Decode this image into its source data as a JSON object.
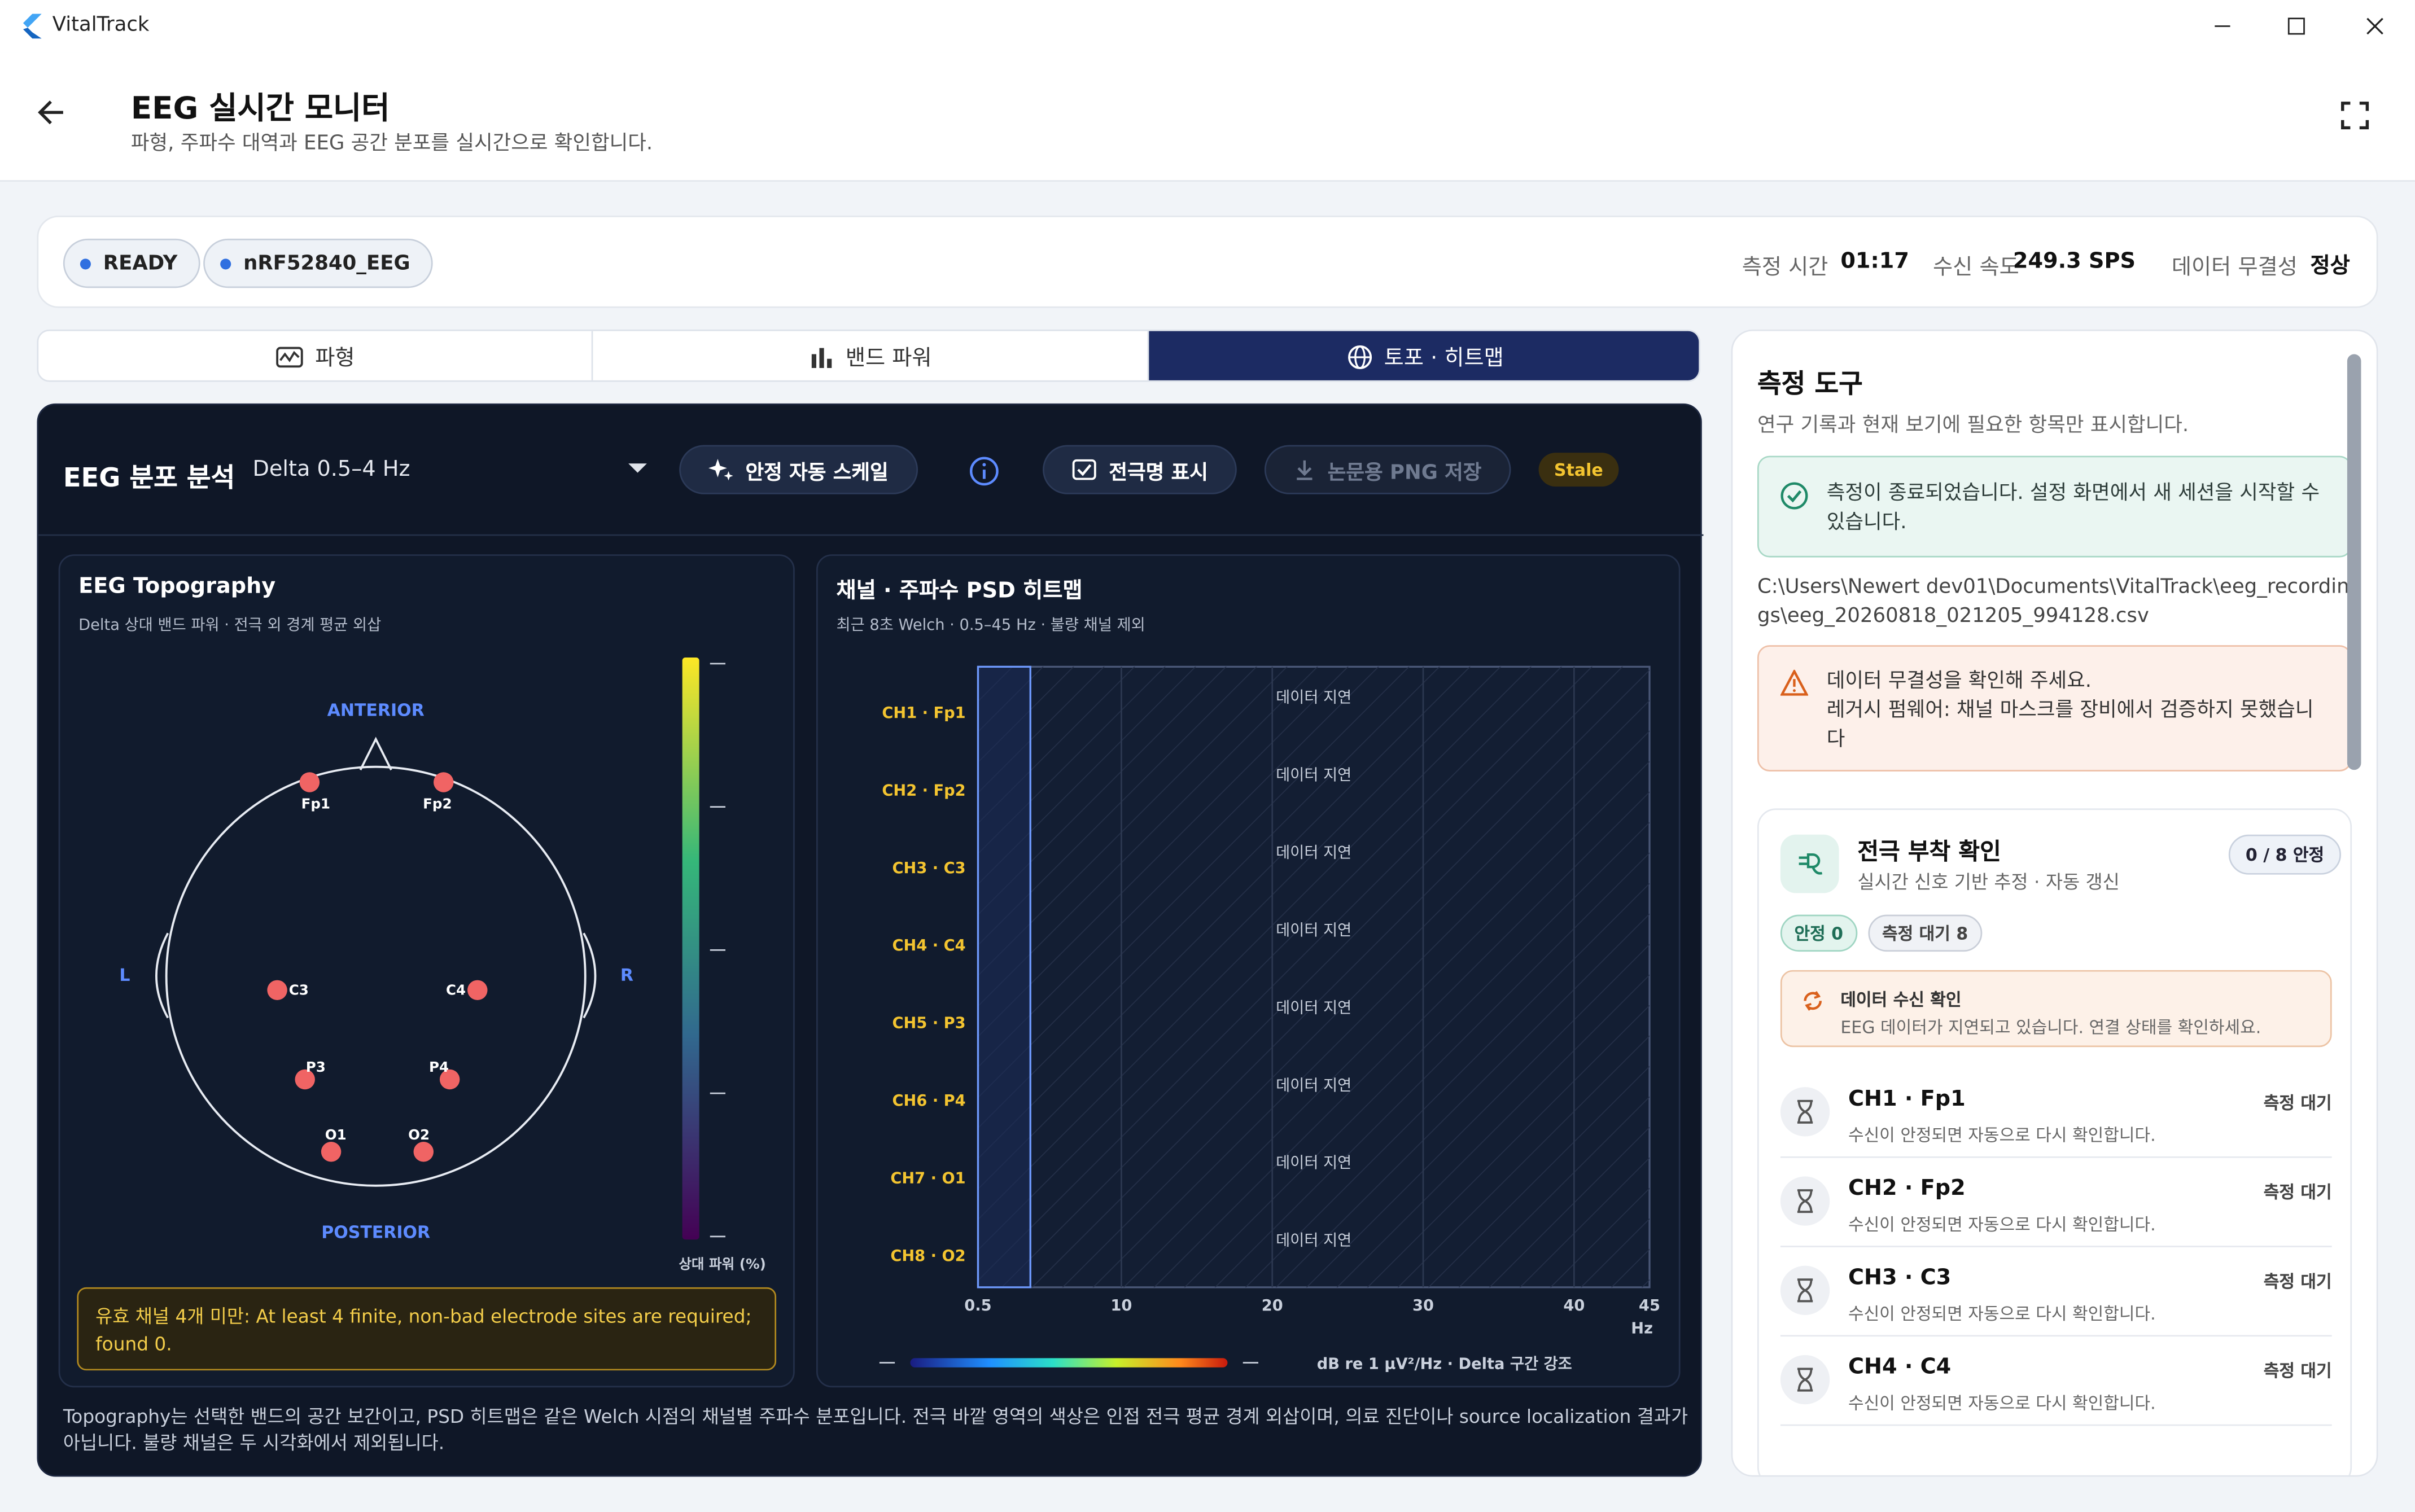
{
  "window": {
    "app_title": "VitalTrack"
  },
  "header": {
    "title": "EEG 실시간 모니터",
    "subtitle": "파형, 주파수 대역과 EEG 공간 분포를 실시간으로 확인합니다."
  },
  "status": {
    "state": "READY",
    "device": "nRF52840_EEG",
    "time_label": "측정 시간",
    "time_value": "01:17",
    "rate_label": "수신 속도",
    "rate_value": "249.3 SPS",
    "integrity_label": "데이터 무결성",
    "integrity_value": "정상"
  },
  "tabs": [
    {
      "label": "파형"
    },
    {
      "label": "밴드 파워"
    },
    {
      "label": "토포 · 히트맵"
    }
  ],
  "toolbar": {
    "title": "EEG 분포 분석",
    "band": "Delta 0.5–4 Hz",
    "autoscale": "안정 자동 스케일",
    "electrode_names": "전극명 표시",
    "save_png": "논문용 PNG 저장",
    "stale": "Stale"
  },
  "topo": {
    "title": "EEG Topography",
    "subtitle": "Delta 상대 밴드 파워 · 전극 외 경계 평균 외삽",
    "anterior": "ANTERIOR",
    "posterior": "POSTERIOR",
    "left": "L",
    "right": "R",
    "electrodes": [
      "Fp1",
      "Fp2",
      "C3",
      "C4",
      "P3",
      "P4",
      "O1",
      "O2"
    ],
    "colorbar_label": "상대 파워 (%)",
    "colors": [
      "#fde725",
      "#35b779",
      "#31688e",
      "#440154"
    ],
    "warning": "유효 채널 4개 미만: At least 4 finite, non-bad electrode sites are required; found 0."
  },
  "heatmap": {
    "title": "채널 · 주파수 PSD 히트맵",
    "subtitle": "최근 8초 Welch · 0.5–45 Hz · 불량 채널 제외",
    "channels": [
      "CH1 · Fp1",
      "CH2 · Fp2",
      "CH3 · C3",
      "CH4 · C4",
      "CH5 · P3",
      "CH6 · P4",
      "CH7 · O1",
      "CH8 · O2"
    ],
    "row_status": "데이터 지연",
    "x_ticks": [
      "0.5",
      "10",
      "20",
      "30",
      "40",
      "45"
    ],
    "x_unit": "Hz",
    "legend": "dB re 1 μV²/Hz · Delta 구간 강조"
  },
  "footnote": "Topography는 선택한 밴드의 공간 보간이고, PSD 히트맵은 같은 Welch 시점의 채널별 주파수 분포입니다. 전극 바깥 영역의 색상은 인접 전극 평균 경계 외삽이며, 의료 진단이나 source localization 결과가 아닙니다. 불량 채널은 두 시각화에서 제외됩니다.",
  "tools": {
    "title": "측정 도구",
    "subtitle": "연구 기록과 현재 보기에 필요한 항목만 표시합니다.",
    "success": "측정이 종료되었습니다. 설정 화면에서 새 세션을 시작할 수 있습니다.",
    "path": "C:\\Users\\Newert dev01\\Documents\\VitalTrack\\eeg_recordings\\eeg_20260818_021205_994128.csv",
    "alert_title": "데이터 무결성을 확인해 주세요.",
    "alert_body": "레거시 펌웨어: 채널 마스크를 장비에서 검증하지 못했습니다",
    "electrode": {
      "title": "전극 부착 확인",
      "subtitle": "실시간 신호 기반 추정 · 자동 갱신",
      "badge": "0 / 8 안정",
      "chip_good": "안정 0",
      "chip_wait": "측정 대기 8",
      "recv_title": "데이터 수신 확인",
      "recv_body": "EEG 데이터가 지연되고 있습니다. 연결 상태를 확인하세요.",
      "rows": [
        {
          "name": "CH1 · Fp1",
          "desc": "수신이 안정되면 자동으로 다시 확인합니다.",
          "status": "측정 대기"
        },
        {
          "name": "CH2 · Fp2",
          "desc": "수신이 안정되면 자동으로 다시 확인합니다.",
          "status": "측정 대기"
        },
        {
          "name": "CH3 · C3",
          "desc": "수신이 안정되면 자동으로 다시 확인합니다.",
          "status": "측정 대기"
        },
        {
          "name": "CH4 · C4",
          "desc": "수신이 안정되면 자동으로 다시 확인합니다.",
          "status": "측정 대기"
        }
      ]
    }
  }
}
